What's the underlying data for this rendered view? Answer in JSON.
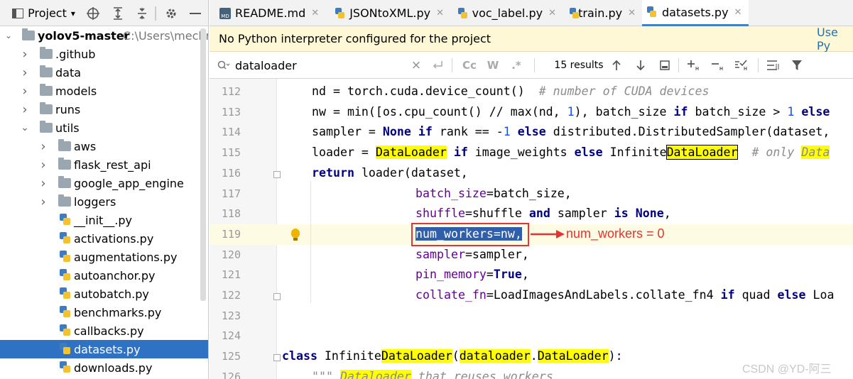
{
  "project_panel": {
    "title": "Project",
    "dropdown_glyph": "▾",
    "toolbar_icons": [
      "locate-icon",
      "expand-all-icon",
      "collapse-all-icon",
      "gear-icon",
      "hide-icon"
    ],
    "root": {
      "name": "yolov5-master",
      "path": "C:\\Users\\mechre"
    },
    "items": [
      {
        "label": ".github",
        "kind": "folder",
        "expanded": false
      },
      {
        "label": "data",
        "kind": "folder",
        "expanded": false
      },
      {
        "label": "models",
        "kind": "folder",
        "expanded": false
      },
      {
        "label": "runs",
        "kind": "folder",
        "expanded": false
      },
      {
        "label": "utils",
        "kind": "folder",
        "expanded": true
      },
      {
        "label": "aws",
        "kind": "folder",
        "expanded": false
      },
      {
        "label": "flask_rest_api",
        "kind": "folder",
        "expanded": false
      },
      {
        "label": "google_app_engine",
        "kind": "folder",
        "expanded": false
      },
      {
        "label": "loggers",
        "kind": "folder",
        "expanded": false
      },
      {
        "label": "__init__.py",
        "kind": "py"
      },
      {
        "label": "activations.py",
        "kind": "py"
      },
      {
        "label": "augmentations.py",
        "kind": "py"
      },
      {
        "label": "autoanchor.py",
        "kind": "py"
      },
      {
        "label": "autobatch.py",
        "kind": "py"
      },
      {
        "label": "benchmarks.py",
        "kind": "py"
      },
      {
        "label": "callbacks.py",
        "kind": "py"
      },
      {
        "label": "datasets.py",
        "kind": "py",
        "selected": true
      },
      {
        "label": "downloads.py",
        "kind": "py"
      }
    ]
  },
  "tabs": [
    {
      "label": "README.md",
      "icon": "markdown-file-icon",
      "icon_text": "MD"
    },
    {
      "label": "JSONtoXML.py",
      "icon": "python-file-icon"
    },
    {
      "label": "voc_label.py",
      "icon": "python-file-icon"
    },
    {
      "label": "train.py",
      "icon": "python-file-icon"
    },
    {
      "label": "datasets.py",
      "icon": "python-file-icon",
      "active": true
    }
  ],
  "banner": {
    "message": "No Python interpreter configured for the project",
    "link": "Use Py"
  },
  "find": {
    "query": "dataloader",
    "results": "15 results",
    "match_case_label": "Cc",
    "whole_word_label": "W",
    "regex_label": ".*"
  },
  "code_lines": [
    {
      "n": "112",
      "segs": [
        [
          "",
          "nd = torch.cuda.device_count()  "
        ],
        [
          "cm",
          "# number of CUDA devices"
        ]
      ]
    },
    {
      "n": "113",
      "segs": [
        [
          "",
          "nw = min([os.cpu_count() // max(nd, "
        ],
        [
          "num",
          "1"
        ],
        [
          "",
          "), batch_size "
        ],
        [
          "kw",
          "if"
        ],
        [
          "",
          " batch_size > "
        ],
        [
          "num",
          "1"
        ],
        [
          "",
          " "
        ],
        [
          "kw",
          "else"
        ]
      ]
    },
    {
      "n": "114",
      "segs": [
        [
          "",
          "sampler = "
        ],
        [
          "kw",
          "None"
        ],
        [
          "",
          " "
        ],
        [
          "kw",
          "if"
        ],
        [
          "",
          " rank == -"
        ],
        [
          "num",
          "1"
        ],
        [
          "",
          " "
        ],
        [
          "kw",
          "else"
        ],
        [
          "",
          " distributed.DistributedSampler(dataset,"
        ]
      ]
    },
    {
      "n": "115",
      "segs": [
        [
          "",
          "loader = "
        ],
        [
          "hl",
          "DataLoader"
        ],
        [
          "",
          " "
        ],
        [
          "kw",
          "if"
        ],
        [
          "",
          " image_weights "
        ],
        [
          "kw",
          "else"
        ],
        [
          "",
          " Infinite"
        ],
        [
          "hlbox",
          "DataLoader"
        ],
        [
          "",
          "  "
        ],
        [
          "cm",
          "# only "
        ],
        [
          "cmhl",
          "Data"
        ]
      ]
    },
    {
      "n": "116",
      "segs": [
        [
          "kw",
          "return"
        ],
        [
          "",
          " loader(dataset,"
        ]
      ]
    },
    {
      "n": "117",
      "segs": [
        [
          "pm",
          "batch_size"
        ],
        [
          "",
          "=batch_size,"
        ]
      ]
    },
    {
      "n": "118",
      "segs": [
        [
          "pm",
          "shuffle"
        ],
        [
          "",
          "=shuffle "
        ],
        [
          "kw",
          "and"
        ],
        [
          "",
          " sampler "
        ],
        [
          "kw",
          "is"
        ],
        [
          "",
          " "
        ],
        [
          "kw",
          "None"
        ],
        [
          "",
          ","
        ]
      ]
    },
    {
      "n": "119",
      "segs": [
        [
          "sel",
          "num_workers=nw,"
        ]
      ]
    },
    {
      "n": "120",
      "segs": [
        [
          "pm",
          "sampler"
        ],
        [
          "",
          "=sampler,"
        ]
      ]
    },
    {
      "n": "121",
      "segs": [
        [
          "pm",
          "pin_memory"
        ],
        [
          "",
          "="
        ],
        [
          "kw",
          "True"
        ],
        [
          "",
          ","
        ]
      ]
    },
    {
      "n": "122",
      "segs": [
        [
          "pm",
          "collate_fn"
        ],
        [
          "",
          "=LoadImagesAndLabels.collate_fn4 "
        ],
        [
          "kw",
          "if"
        ],
        [
          "",
          " quad "
        ],
        [
          "kw",
          "else"
        ],
        [
          "",
          " Loa"
        ]
      ]
    },
    {
      "n": "123",
      "segs": []
    },
    {
      "n": "124",
      "segs": []
    },
    {
      "n": "125",
      "segs": [
        [
          "kw",
          "class"
        ],
        [
          "",
          " Infinite"
        ],
        [
          "hl",
          "DataLoader"
        ],
        [
          "",
          "("
        ],
        [
          "hl",
          "dataloader"
        ],
        [
          "",
          "."
        ],
        [
          "hl",
          "DataLoader"
        ],
        [
          "",
          "):"
        ]
      ]
    },
    {
      "n": "126",
      "segs": [
        [
          "cm",
          "\"\"\" "
        ],
        [
          "cmhl",
          "Dataloader"
        ],
        [
          "cm",
          " that reuses workers"
        ]
      ]
    }
  ],
  "annotation": {
    "text": "num_workers = 0",
    "color": "#e53333"
  },
  "watermark": "CSDN @YD-阿三",
  "colors": {
    "selection": "#2f72c4",
    "keyword": "#000080",
    "number": "#1750eb",
    "comment": "#8c8c8c",
    "param": "#660099",
    "highlight": "#ffff00"
  }
}
